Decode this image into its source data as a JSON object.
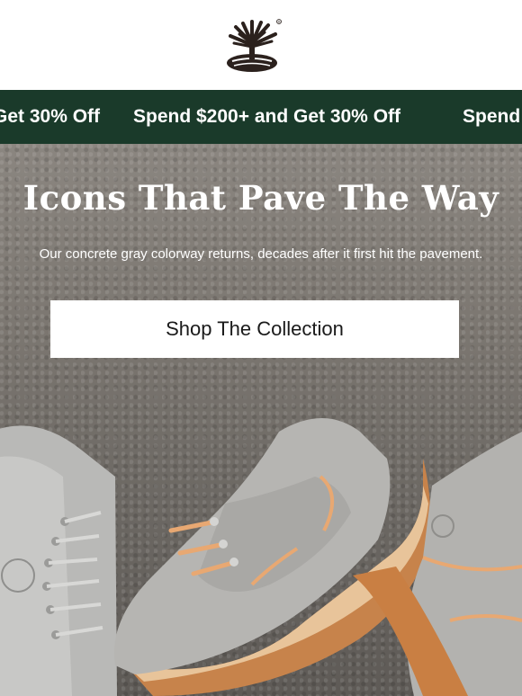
{
  "brand": {
    "logo_icon": "timberland-tree-logo-icon",
    "registered_mark": "®"
  },
  "promo_banner": {
    "items": [
      "Get 30% Off",
      "Spend $200+ and Get 30% Off",
      "Spend"
    ],
    "background": "#1a3a2a",
    "text_color": "#ffffff"
  },
  "hero": {
    "title": "Icons That Pave The Way",
    "subtitle": "Our concrete gray colorway returns, decades after it first hit the pavement.",
    "cta_label": "Shop The Collection",
    "image_subject": "gray suede boots and boat shoes"
  }
}
